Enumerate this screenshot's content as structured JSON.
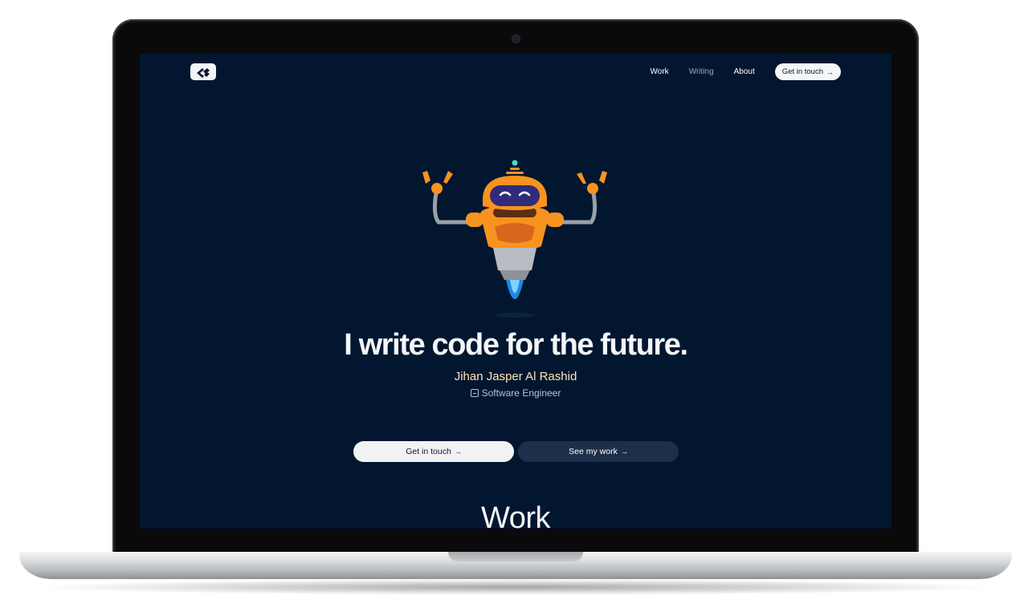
{
  "nav": {
    "logo_icon": "brand-logo-icon",
    "links": [
      "Work",
      "Writing",
      "About"
    ],
    "cta_label": "Get in touch",
    "cta_icon": "arrow-right-icon"
  },
  "hero": {
    "illustration": "robot-mascot-illustration",
    "headline": "I write code for the future.",
    "name": "Jihan Jasper Al Rashid",
    "role_icon": "code-icon",
    "role": "Software Engineer",
    "primary_button": "Get in touch",
    "secondary_button": "See my work",
    "button_icon": "arrow-right-icon"
  },
  "sections": {
    "work_title": "Work"
  },
  "colors": {
    "background": "#021630",
    "accent_name": "#ffe6b3",
    "robot_orange": "#f7931e",
    "button_light": "#f1f2f4",
    "button_dark": "#1e3049"
  }
}
